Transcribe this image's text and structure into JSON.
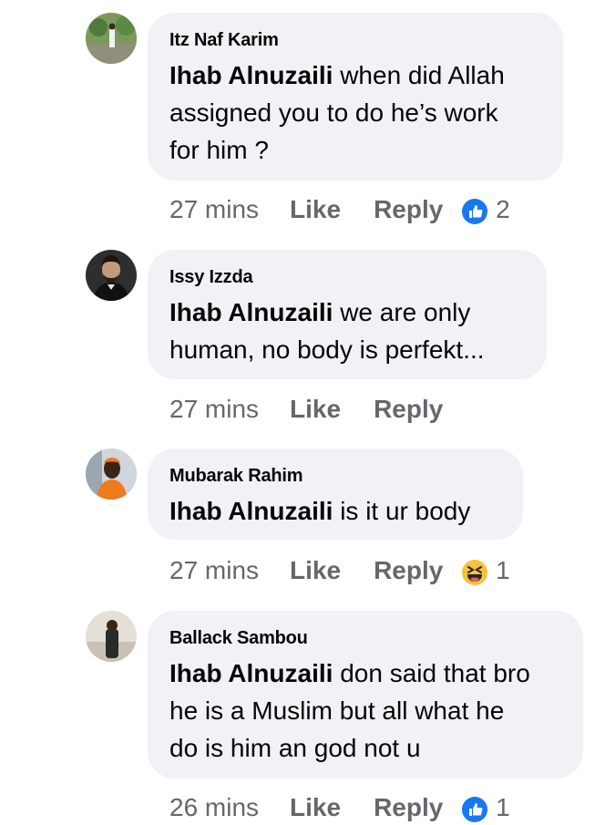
{
  "comments": [
    {
      "author": "Itz Naf Karim",
      "mention": "Ihab Alnuzaili",
      "lines": [
        " when did Allah",
        "assigned you to do he’s work",
        "for him ?"
      ],
      "time": "27 mins",
      "like_label": "Like",
      "reply_label": "Reply",
      "reaction": {
        "icon": "like-reaction-icon",
        "count": "2"
      }
    },
    {
      "author": "Issy Izzda",
      "mention": "Ihab Alnuzaili",
      "lines": [
        " we are only",
        "human, no body is perfekt..."
      ],
      "time": "27 mins",
      "like_label": "Like",
      "reply_label": "Reply",
      "reaction": null
    },
    {
      "author": "Mubarak Rahim",
      "mention": "Ihab Alnuzaili",
      "lines": [
        " is it ur body"
      ],
      "time": "27 mins",
      "like_label": "Like",
      "reply_label": "Reply",
      "reaction": {
        "icon": "haha-reaction-icon",
        "count": "1"
      }
    },
    {
      "author": "Ballack Sambou",
      "mention": "Ihab Alnuzaili",
      "lines": [
        " don said that bro",
        "he is a Muslim but all what he",
        "do is him an god not u"
      ],
      "time": "26 mins",
      "like_label": "Like",
      "reply_label": "Reply",
      "reaction": {
        "icon": "like-reaction-icon",
        "count": "1"
      }
    }
  ],
  "colors": {
    "bubble": "#f0f2f5",
    "meta_text": "#65676b",
    "like_blue": "#1877f2",
    "haha_yellow": "#f7c23b"
  }
}
